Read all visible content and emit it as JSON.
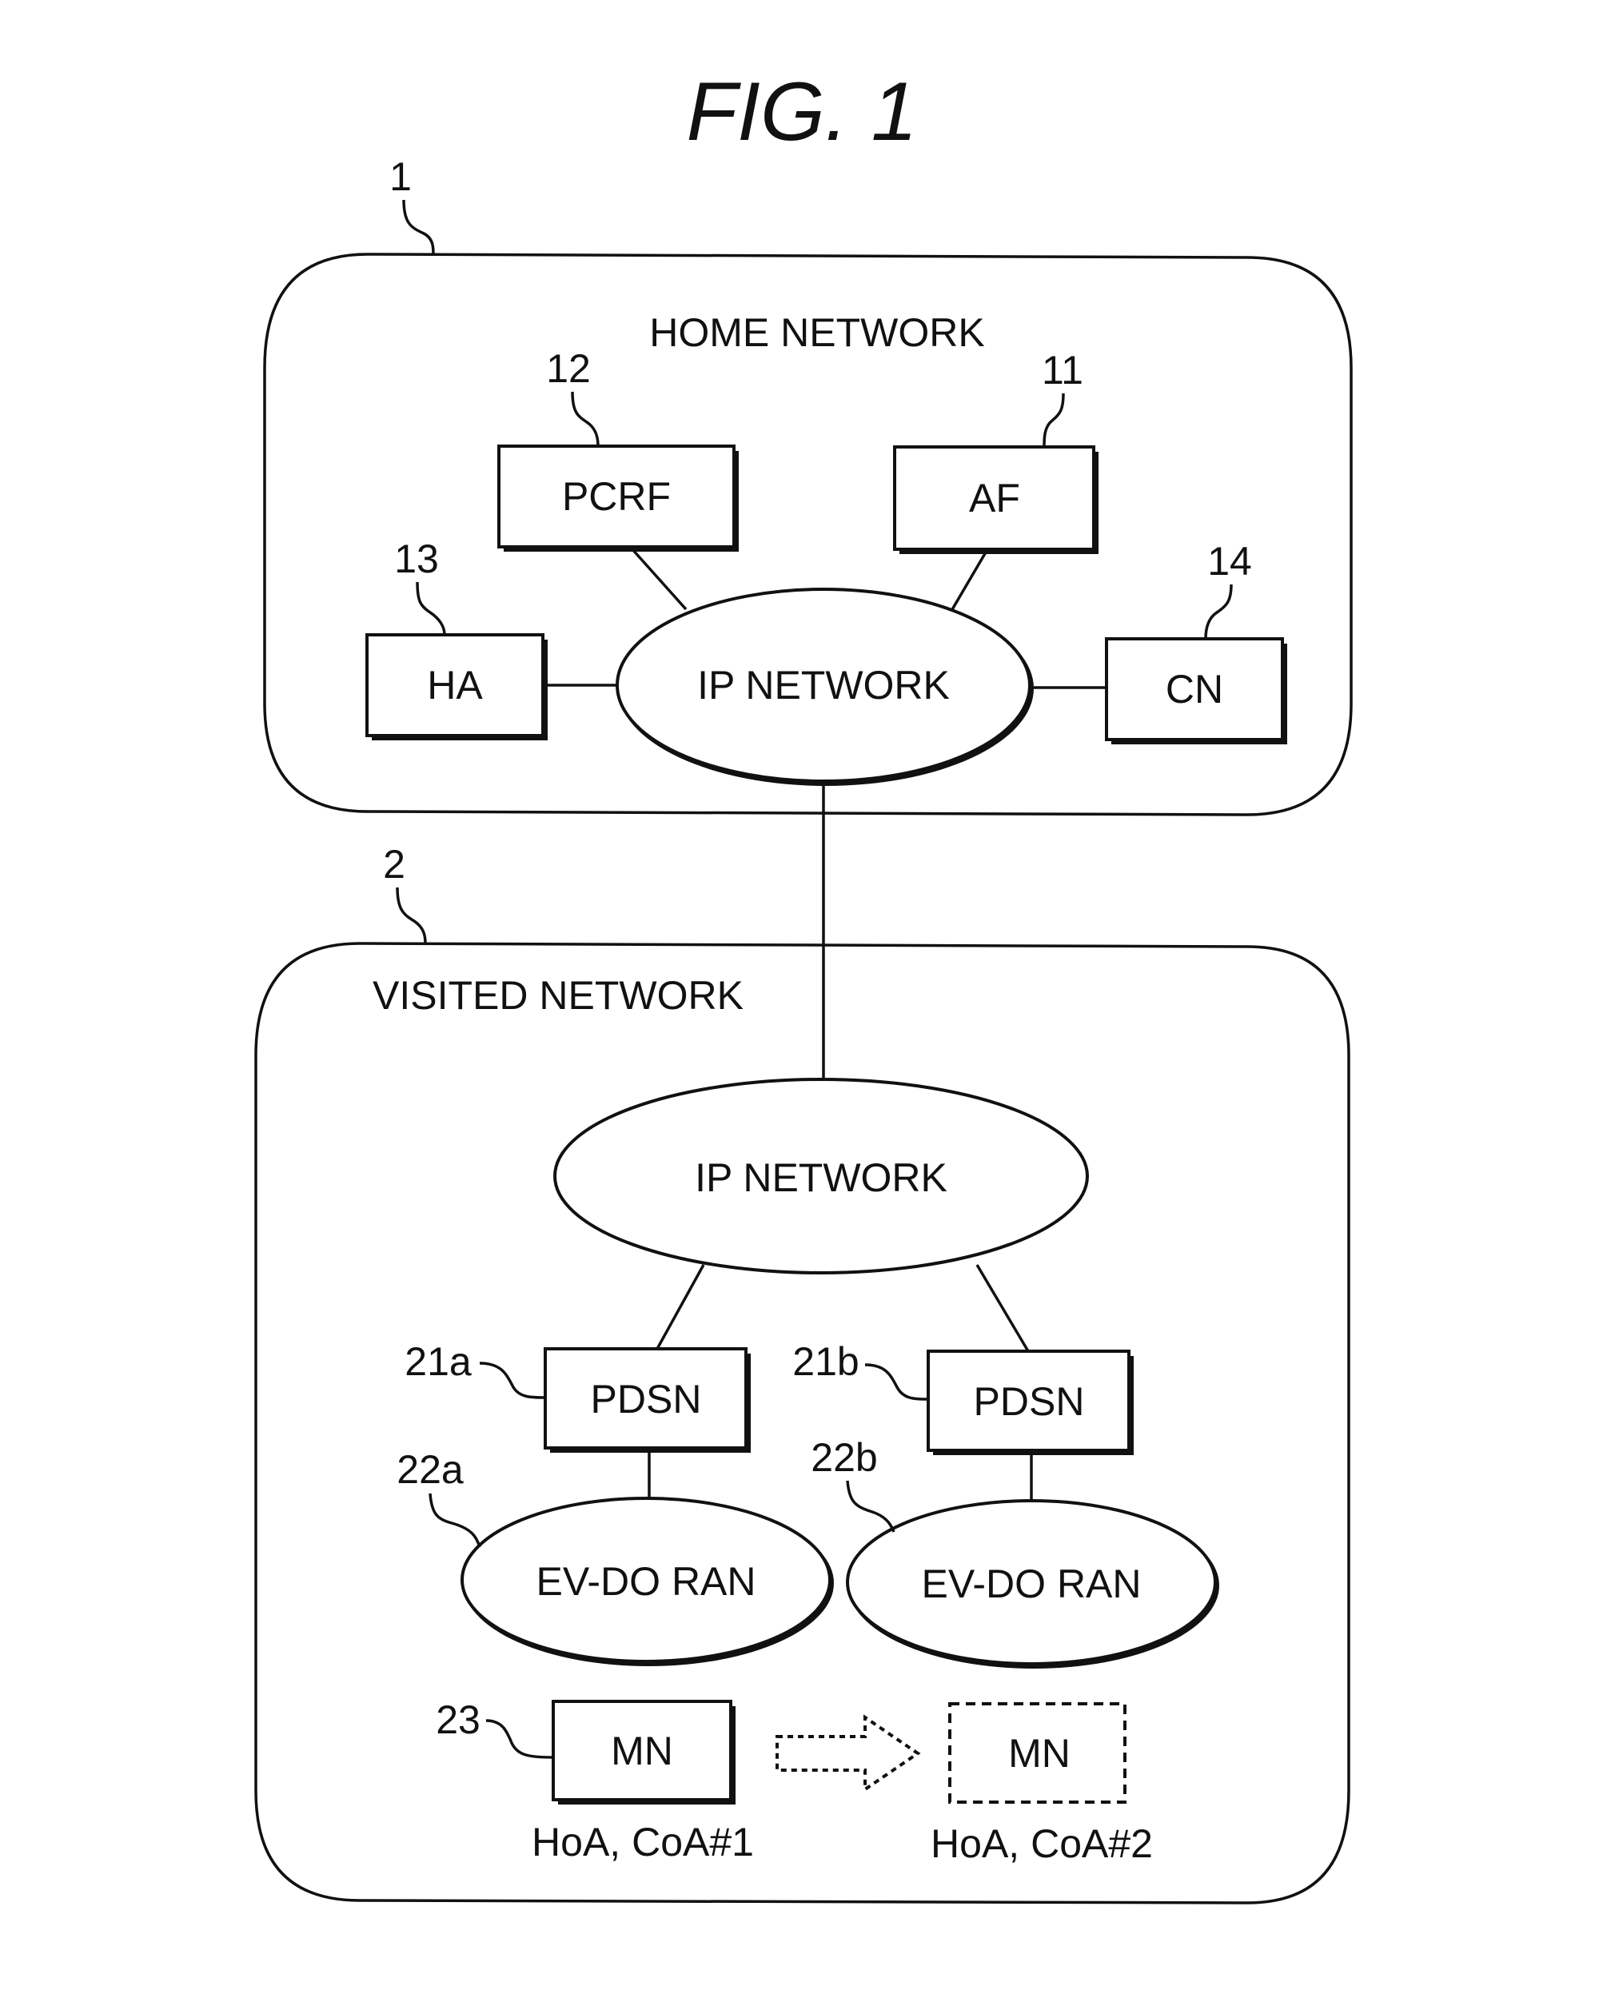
{
  "figure": {
    "title": "FIG. 1"
  },
  "home_network": {
    "ref": "1",
    "title": "HOME NETWORK",
    "ip_network": {
      "label": "IP NETWORK"
    },
    "nodes": [
      {
        "id": "pcrf",
        "label": "PCRF",
        "ref": "12"
      },
      {
        "id": "af",
        "label": "AF",
        "ref": "11"
      },
      {
        "id": "ha",
        "label": "HA",
        "ref": "13"
      },
      {
        "id": "cn",
        "label": "CN",
        "ref": "14"
      }
    ]
  },
  "visited_network": {
    "ref": "2",
    "title": "VISITED NETWORK",
    "ip_network": {
      "label": "IP NETWORK"
    },
    "pdsn": [
      {
        "label": "PDSN",
        "ref": "21a"
      },
      {
        "label": "PDSN",
        "ref": "21b"
      }
    ],
    "ran": [
      {
        "label": "EV-DO RAN",
        "ref": "22a"
      },
      {
        "label": "EV-DO RAN",
        "ref": "22b"
      }
    ],
    "mobile_node": {
      "ref": "23",
      "label": "MN",
      "before": {
        "label": "MN",
        "address": "HoA, CoA#1",
        "style": "solid"
      },
      "after": {
        "label": "MN",
        "address": "HoA, CoA#2",
        "style": "dashed"
      },
      "movement": "moves-right"
    }
  },
  "connections": [
    [
      "home.ip_network",
      "pcrf"
    ],
    [
      "home.ip_network",
      "af"
    ],
    [
      "home.ip_network",
      "ha"
    ],
    [
      "home.ip_network",
      "cn"
    ],
    [
      "home.ip_network",
      "visited.ip_network"
    ],
    [
      "visited.ip_network",
      "pdsn_a"
    ],
    [
      "visited.ip_network",
      "pdsn_b"
    ],
    [
      "pdsn_a",
      "ran_a"
    ],
    [
      "pdsn_b",
      "ran_b"
    ]
  ]
}
